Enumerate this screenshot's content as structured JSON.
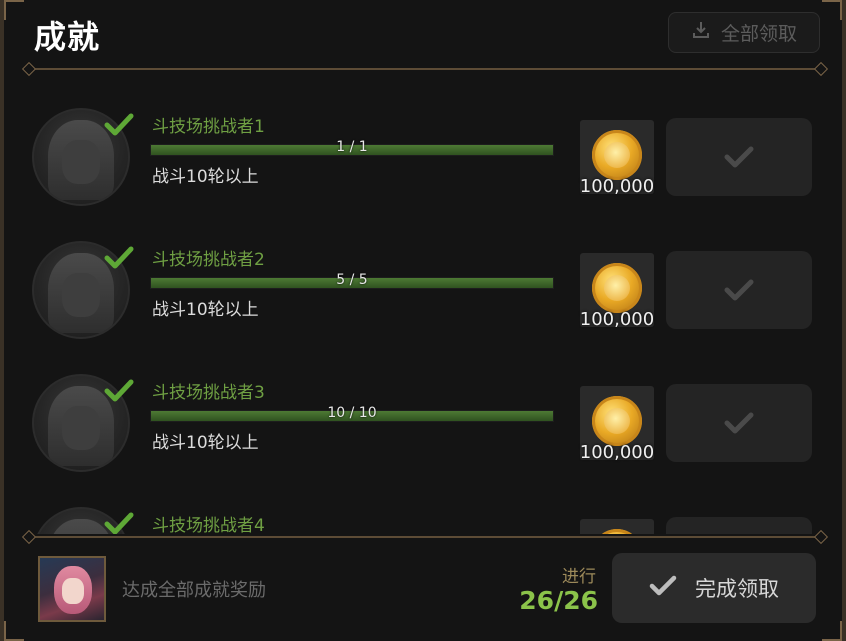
{
  "header": {
    "title": "成就",
    "claim_all_label": "全部领取"
  },
  "achievements": [
    {
      "name": "斗技场挑战者1",
      "progress_text": "1 / 1",
      "progress": 1.0,
      "description": "战斗10轮以上",
      "reward_amount": "100,000",
      "reward_icon": "gold-coin-icon",
      "claimed": true
    },
    {
      "name": "斗技场挑战者2",
      "progress_text": "5 / 5",
      "progress": 1.0,
      "description": "战斗10轮以上",
      "reward_amount": "100,000",
      "reward_icon": "gold-coin-icon",
      "claimed": true
    },
    {
      "name": "斗技场挑战者3",
      "progress_text": "10 / 10",
      "progress": 1.0,
      "description": "战斗10轮以上",
      "reward_amount": "100,000",
      "reward_icon": "gold-coin-icon",
      "claimed": true
    },
    {
      "name": "斗技场挑战者4",
      "progress_text": "",
      "progress": 1.0,
      "description": "",
      "reward_amount": "",
      "reward_icon": "gold-coin-icon",
      "claimed": true
    }
  ],
  "footer": {
    "reward_text": "达成全部成就奖励",
    "progress_label": "进行",
    "progress_count": "26/26",
    "complete_label": "完成领取"
  },
  "colors": {
    "accent_green": "#8bc34a",
    "name_green": "#6fa043",
    "frame_gold": "#7a6448"
  }
}
